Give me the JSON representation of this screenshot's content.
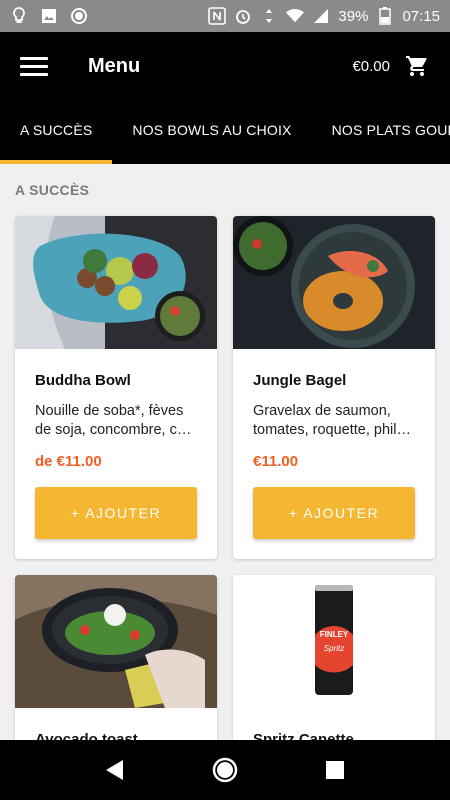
{
  "status_bar": {
    "battery": "39%",
    "time": "07:15"
  },
  "app_bar": {
    "title": "Menu",
    "cart_total": "€0.00"
  },
  "tabs": [
    {
      "label": "A SUCCÈS"
    },
    {
      "label": "NOS BOWLS AU CHOIX"
    },
    {
      "label": "NOS PLATS GOURMANDS"
    }
  ],
  "section": {
    "title": "A SUCCÈS"
  },
  "products": [
    {
      "name": "Buddha Bowl",
      "desc": "Nouille de soba*, fèves de soja, concombre, c…",
      "price": "de €11.00",
      "button": "+ AJOUTER"
    },
    {
      "name": "Jungle Bagel",
      "desc": "Gravelax de saumon, tomates, roquette, phil…",
      "price": "€11.00",
      "button": "+ AJOUTER"
    },
    {
      "name": "Avocado toast"
    },
    {
      "name": "Spritz Canette",
      "can_brand": "FINLEY",
      "can_flavor": "Spritz"
    }
  ],
  "colors": {
    "accent": "#f5b731",
    "price": "#f25f22",
    "bar": "#000000"
  }
}
